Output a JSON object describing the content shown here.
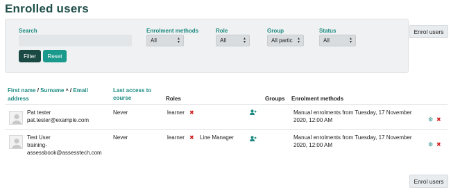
{
  "page": {
    "title": "Enrolled users"
  },
  "enrol_button_label": "Enrol users",
  "filters": {
    "search_label": "Search",
    "search_value": "",
    "enrolment_methods": {
      "label": "Enrolment methods",
      "value": "All"
    },
    "role": {
      "label": "Role",
      "value": "All"
    },
    "group": {
      "label": "Group",
      "value": "All partic"
    },
    "status": {
      "label": "Status",
      "value": "All"
    },
    "filter_button": "Filter",
    "reset_button": "Reset"
  },
  "table": {
    "columns": {
      "first_name": "First name",
      "sep1": " / ",
      "surname": "Surname",
      "sort_arrow": "^",
      "sep2": " / ",
      "email": "Email address",
      "last_access": "Last access to course",
      "roles": "Roles",
      "groups": "Groups",
      "enrolment_methods": "Enrolment methods"
    },
    "rows": [
      {
        "name": "Pat tester",
        "email": "pat.tester@example.com",
        "last_access": "Never",
        "roles": [
          "learner"
        ],
        "enrolment": "Manual enrolments from Tuesday, 17 November 2020, 12:00 AM"
      },
      {
        "name": "Test User",
        "email": "training-assessbook@assesstech.com",
        "last_access": "Never",
        "roles": [
          "learner",
          "Line Manager"
        ],
        "enrolment": "Manual enrolments from Tuesday, 17 November 2020, 12:00 AM"
      }
    ]
  },
  "colors": {
    "accent": "#1a8a80",
    "dark_button": "#1b4a45",
    "remove": "#d21a1a"
  }
}
